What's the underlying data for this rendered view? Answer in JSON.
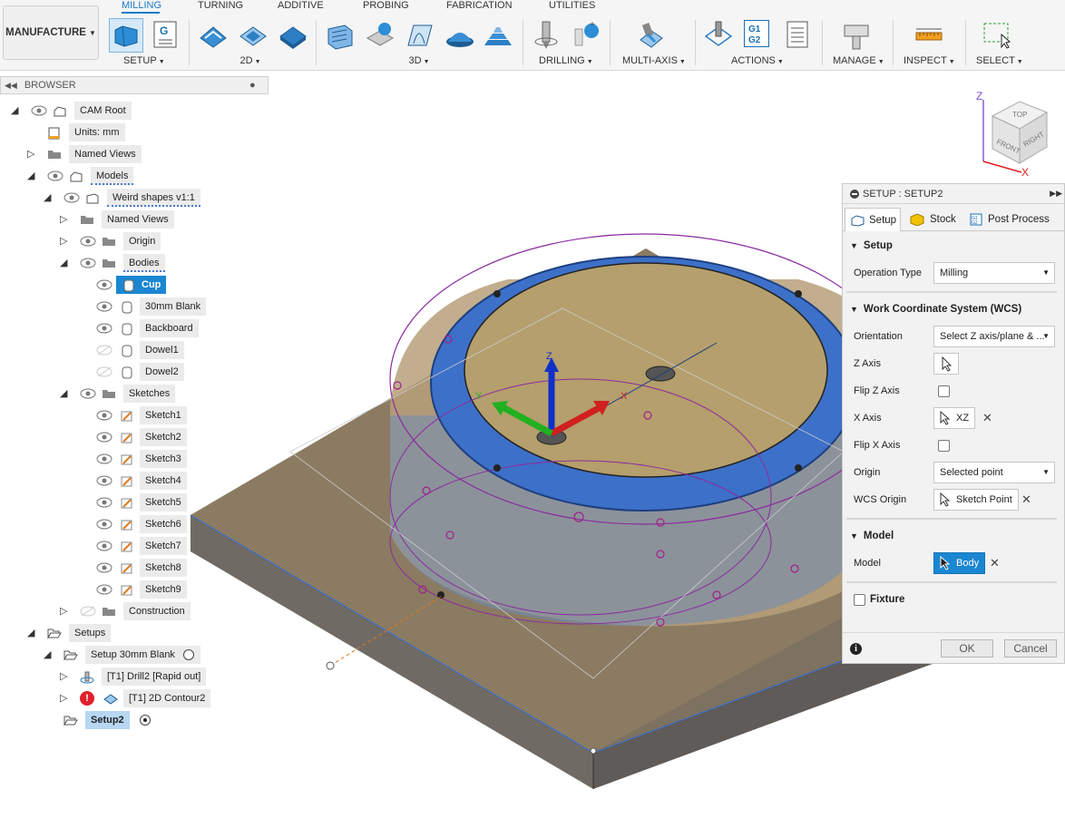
{
  "toolbar": {
    "workspace": "MANUFACTURE",
    "tabs": [
      "MILLING",
      "TURNING",
      "ADDITIVE",
      "PROBING",
      "FABRICATION",
      "UTILITIES"
    ],
    "groups": {
      "setup": "SETUP",
      "twod": "2D",
      "threed": "3D",
      "drilling": "DRILLING",
      "multiaxis": "MULTI-AXIS",
      "actions": "ACTIONS",
      "manage": "MANAGE",
      "inspect": "INSPECT",
      "select": "SELECT"
    },
    "g1g2": "G1\nG2",
    "g_label": "G"
  },
  "browser": {
    "title": "BROWSER",
    "rows": {
      "cam_root": "CAM Root",
      "units": "Units: mm",
      "named_views": "Named Views",
      "models": "Models",
      "weird_shapes": "Weird shapes v1:1",
      "named_views_2": "Named Views",
      "origin": "Origin",
      "bodies": "Bodies",
      "cup": "Cup",
      "blank": "30mm Blank",
      "backboard": "Backboard",
      "dowel1": "Dowel1",
      "dowel2": "Dowel2",
      "sketches": "Sketches",
      "sketch1": "Sketch1",
      "sketch2": "Sketch2",
      "sketch3": "Sketch3",
      "sketch4": "Sketch4",
      "sketch5": "Sketch5",
      "sketch6": "Sketch6",
      "sketch7": "Sketch7",
      "sketch8": "Sketch8",
      "sketch9": "Sketch9",
      "construction": "Construction",
      "setups": "Setups",
      "setup_blank": "Setup 30mm Blank",
      "drill2": "[T1] Drill2 [Rapid out]",
      "contour2": "[T1] 2D Contour2",
      "setup2": "Setup2"
    }
  },
  "viewcube": {
    "top": "TOP",
    "front": "FRONT",
    "right": "RIGHT",
    "z": "Z",
    "x": "X"
  },
  "viewport_axes": {
    "z": "Z",
    "y": "Y",
    "x": "X"
  },
  "dialog": {
    "title": "SETUP : SETUP2",
    "tabs": {
      "setup": "Setup",
      "stock": "Stock",
      "post": "Post Process"
    },
    "sections": {
      "setup": "Setup",
      "wcs": "Work Coordinate System (WCS)",
      "model": "Model",
      "fixture": "Fixture"
    },
    "fields": {
      "operation_type_label": "Operation Type",
      "operation_type_value": "Milling",
      "orientation_label": "Orientation",
      "orientation_value": "Select Z axis/plane & ...",
      "z_axis_label": "Z Axis",
      "flip_z_label": "Flip Z Axis",
      "x_axis_label": "X Axis",
      "x_axis_value": "XZ",
      "flip_x_label": "Flip X Axis",
      "origin_label": "Origin",
      "origin_value": "Selected point",
      "wcs_origin_label": "WCS Origin",
      "wcs_origin_value": "Sketch Point",
      "model_label": "Model",
      "model_value": "Body"
    },
    "ok": "OK",
    "cancel": "Cancel"
  },
  "colors": {
    "accent": "#1a7ac8",
    "selection": "#1b86d1",
    "error": "#e0202a"
  }
}
